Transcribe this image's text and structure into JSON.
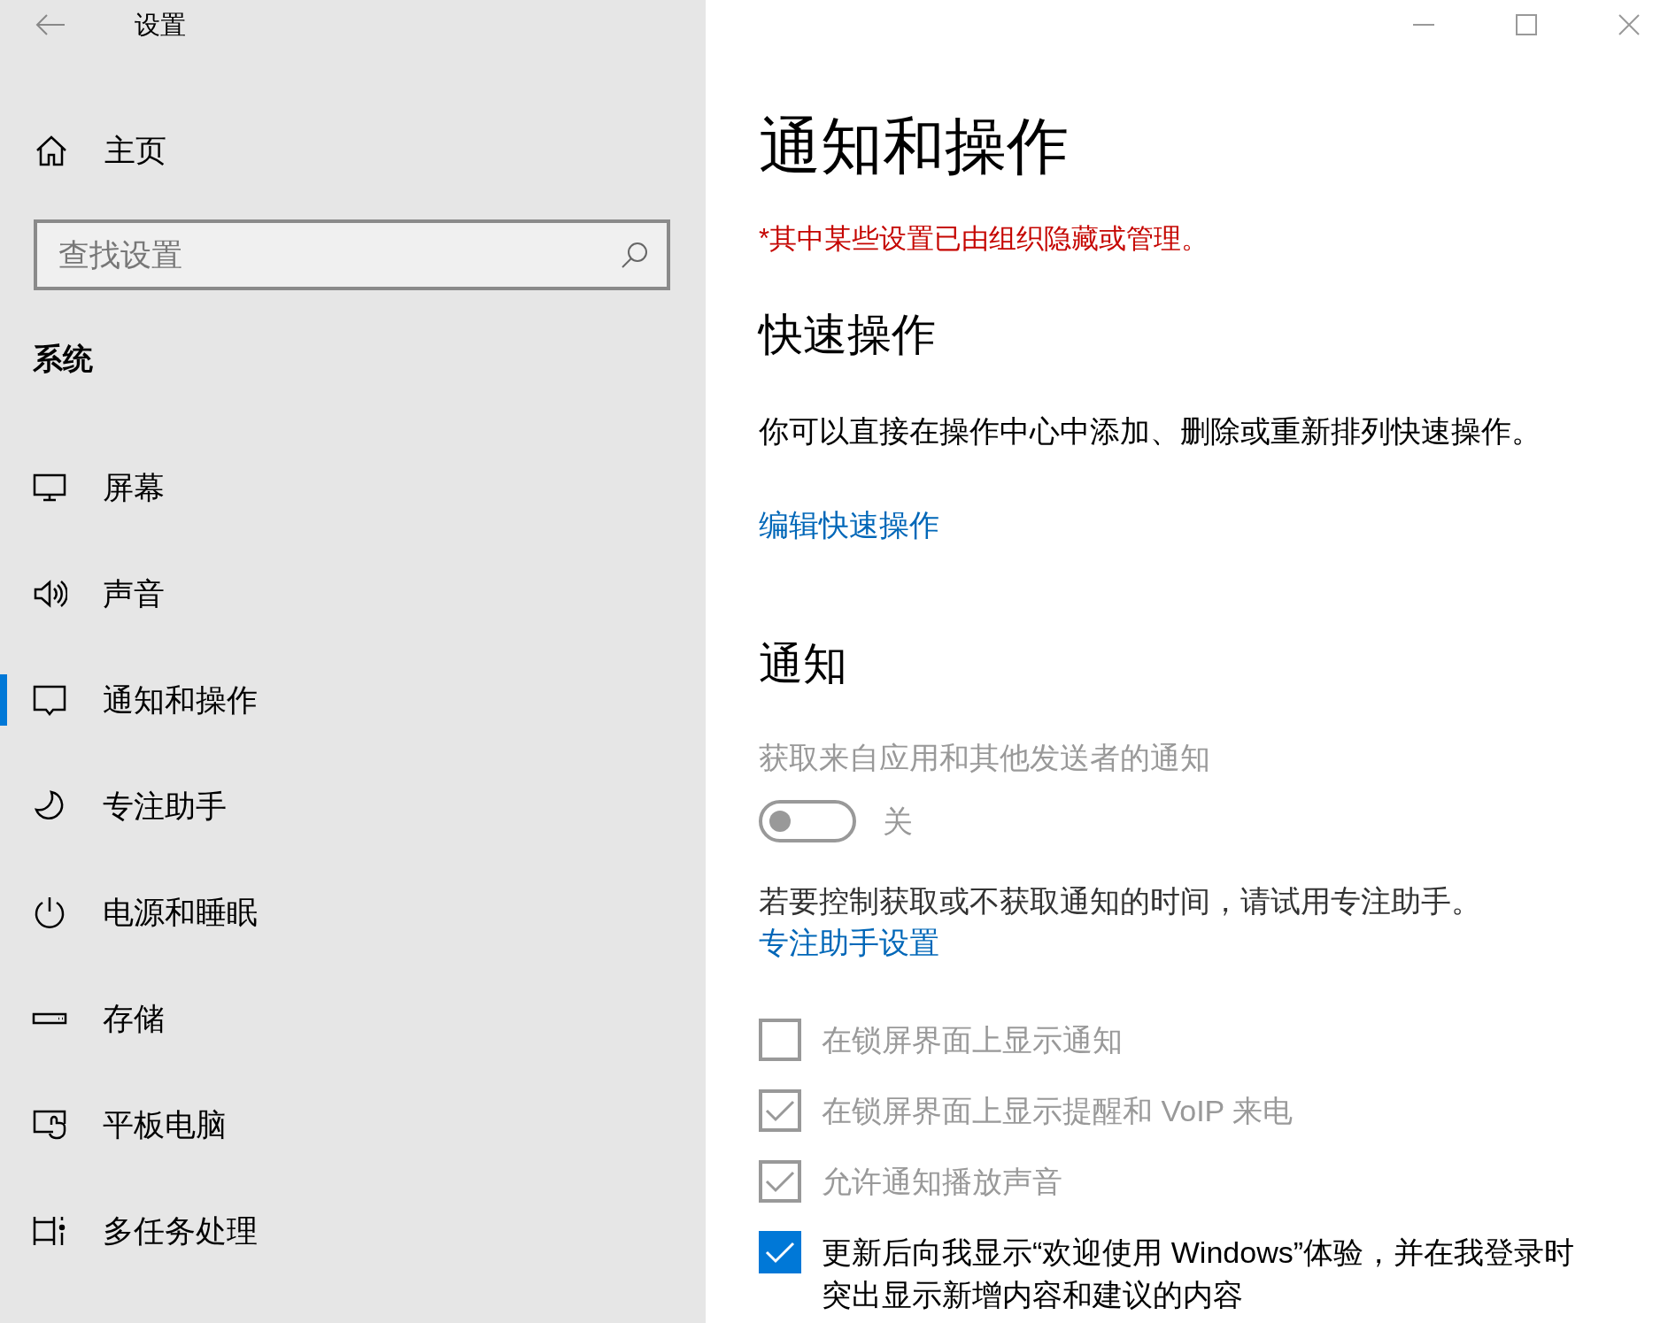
{
  "window": {
    "title": "设置"
  },
  "sidebar": {
    "home": "主页",
    "search": {
      "placeholder": "查找设置"
    },
    "section": "系统",
    "items": [
      {
        "label": "屏幕",
        "kind": "display",
        "selected": false
      },
      {
        "label": "声音",
        "kind": "sound",
        "selected": false
      },
      {
        "label": "通知和操作",
        "kind": "notifications",
        "selected": true
      },
      {
        "label": "专注助手",
        "kind": "moon",
        "selected": false
      },
      {
        "label": "电源和睡眠",
        "kind": "power",
        "selected": false
      },
      {
        "label": "存储",
        "kind": "storage",
        "selected": false
      },
      {
        "label": "平板电脑",
        "kind": "tablet",
        "selected": false
      },
      {
        "label": "多任务处理",
        "kind": "multitask",
        "selected": false
      }
    ]
  },
  "page": {
    "title": "通知和操作",
    "notice": "*其中某些设置已由组织隐藏或管理。",
    "quick_actions": {
      "heading": "快速操作",
      "description": "你可以直接在操作中心中添加、删除或重新排列快速操作。",
      "link": "编辑快速操作"
    },
    "notifications": {
      "heading": "通知",
      "toggle": {
        "label": "获取来自应用和其他发送者的通知",
        "on": false,
        "disabled": true,
        "state_text": "关"
      },
      "hint": "若要控制获取或不获取通知的时间，请试用专注助手。",
      "hint_link": "专注助手设置",
      "options": [
        {
          "label": "在锁屏界面上显示通知",
          "checked": false,
          "disabled": true
        },
        {
          "label": "在锁屏界面上显示提醒和 VoIP 来电",
          "checked": true,
          "disabled": true
        },
        {
          "label": "允许通知播放声音",
          "checked": true,
          "disabled": true
        },
        {
          "label": "更新后向我显示“欢迎使用 Windows”体验，并在我登录时突出显示新增内容和建议的内容",
          "checked": true,
          "disabled": false
        }
      ]
    }
  }
}
